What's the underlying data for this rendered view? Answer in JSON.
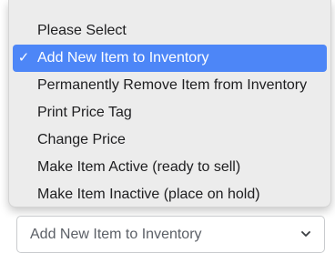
{
  "dropdown": {
    "options": [
      {
        "label": "Please Select",
        "checked": false
      },
      {
        "label": "Add New Item to Inventory",
        "checked": true
      },
      {
        "label": "Permanently Remove Item from Inventory",
        "checked": false
      },
      {
        "label": "Print Price Tag",
        "checked": false
      },
      {
        "label": "Change Price",
        "checked": false
      },
      {
        "label": "Make Item Active (ready to sell)",
        "checked": false
      },
      {
        "label": "Make Item Inactive (place on hold)",
        "checked": false
      }
    ],
    "check_glyph": "✓",
    "highlight_color": "#4d86f7"
  },
  "select": {
    "value": "Add New Item to Inventory",
    "icon": "chevron-down-icon"
  }
}
